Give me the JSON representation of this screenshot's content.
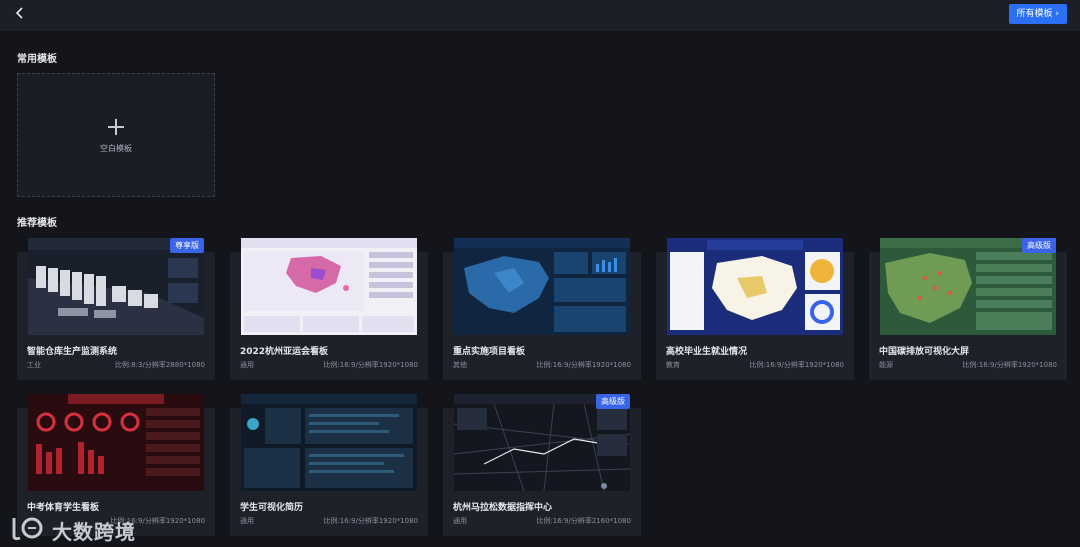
{
  "header": {
    "back_icon": "chevron-left-icon",
    "all_templates_label": "所有模板 ›"
  },
  "common": {
    "title": "常用模板",
    "blank_label": "空白模板"
  },
  "recommended": {
    "title": "推荐模板",
    "cards": [
      {
        "name": "智能仓库生产监测系统",
        "category": "工业",
        "ratio": "比例:8:3/分辨率2880*1080",
        "badge": "尊享版"
      },
      {
        "name": "2022杭州亚运会看板",
        "category": "通用",
        "ratio": "比例:16:9/分辨率1920*1080",
        "badge": ""
      },
      {
        "name": "重点实施项目看板",
        "category": "其他",
        "ratio": "比例:16:9/分辨率1920*1080",
        "badge": ""
      },
      {
        "name": "高校毕业生就业情况",
        "category": "教育",
        "ratio": "比例:16:9/分辨率1920*1080",
        "badge": ""
      },
      {
        "name": "中国碳排放可视化大屏",
        "category": "能源",
        "ratio": "比例:16:9/分辨率1920*1080",
        "badge": "高级版"
      },
      {
        "name": "中考体育学生看板",
        "category": "",
        "ratio": "比例:16:9/分辨率1920*1080",
        "badge": ""
      },
      {
        "name": "学生可视化简历",
        "category": "通用",
        "ratio": "比例:16:9/分辨率1920*1080",
        "badge": ""
      },
      {
        "name": "杭州马拉松数据指挥中心",
        "category": "通用",
        "ratio": "比例:16:9/分辨率2160*1080",
        "badge": "高级版"
      }
    ]
  },
  "watermark": {
    "text": "大数跨境"
  },
  "colors": {
    "background": "#13151b",
    "card": "#1e212a",
    "accent": "#2a6ff4",
    "badge": "#3a64e8"
  }
}
